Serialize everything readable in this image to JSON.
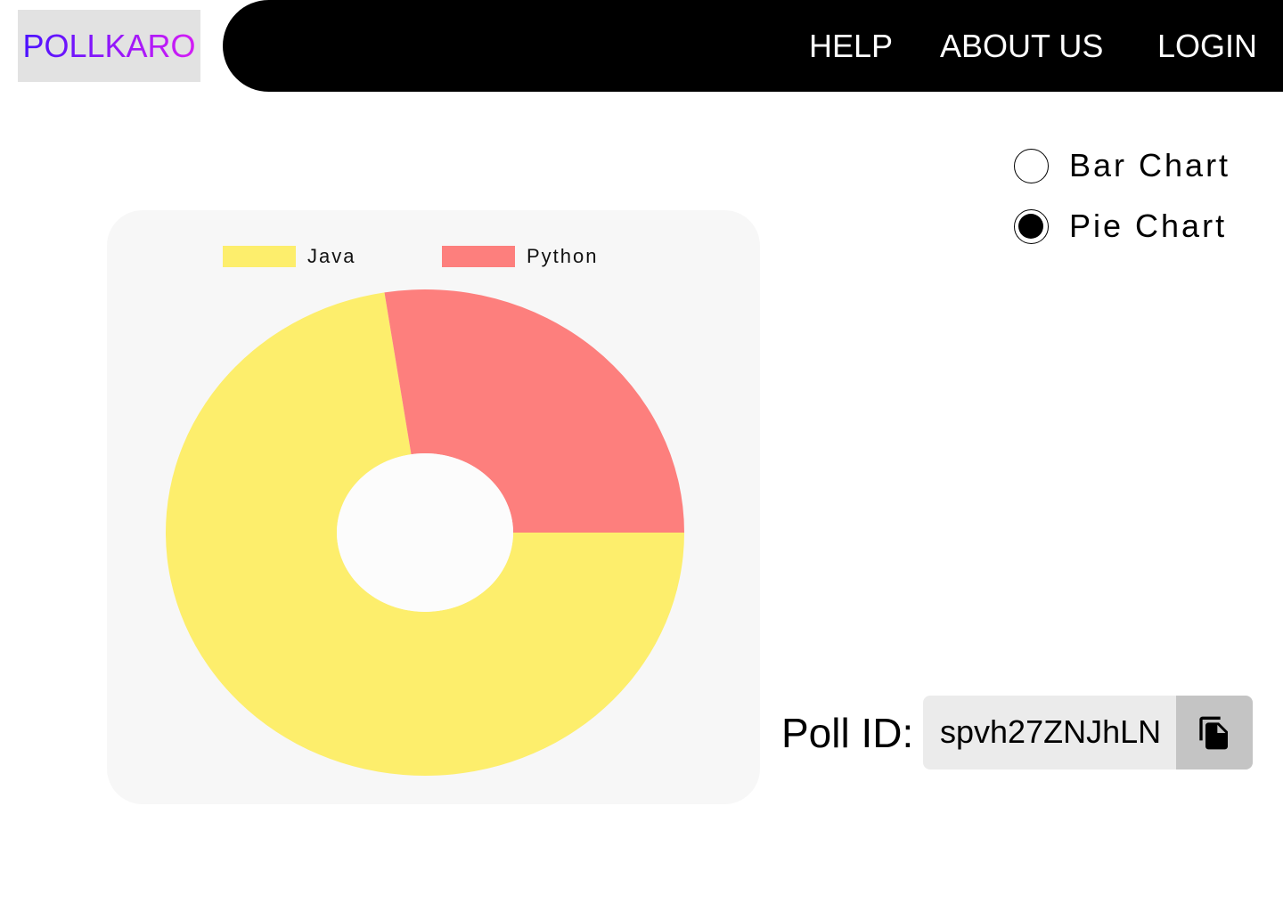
{
  "brand": {
    "name": "POLLKARO"
  },
  "nav": {
    "help": "HELP",
    "about": "ABOUT US",
    "login": "LOGIN"
  },
  "chart_options": [
    {
      "label": "Bar Chart",
      "selected": false
    },
    {
      "label": "Pie Chart",
      "selected": true
    }
  ],
  "poll": {
    "label": "Poll ID:",
    "id": "spvh27ZNJhLN",
    "copy_icon": "copy-icon"
  },
  "chart_data": {
    "type": "pie",
    "categories": [
      "Java",
      "Python"
    ],
    "values": [
      72.5,
      27.5
    ],
    "colors": [
      "#fdee6c",
      "#fd7f7d"
    ],
    "donut": true,
    "legend": "top"
  }
}
